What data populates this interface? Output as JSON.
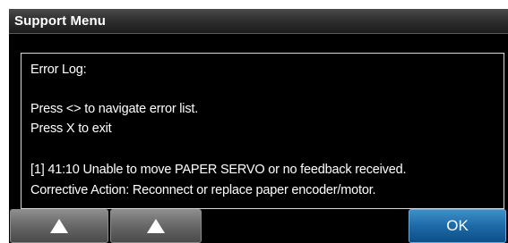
{
  "window": {
    "title": "Support Menu"
  },
  "log": {
    "header": "Error Log:",
    "instructions": [
      "Press <> to navigate error list.",
      "Press X to exit"
    ],
    "entries": [
      {
        "line": "[1] 41:10 Unable to move PAPER SERVO or no feedback received.",
        "action": "Corrective Action: Reconnect or replace paper encoder/motor."
      }
    ]
  },
  "softkeys": {
    "key1_icon": "up-triangle-icon",
    "key2_icon": "up-triangle-icon",
    "ok_label": "OK",
    "colors": {
      "gray": "#6a6a6a",
      "blue": "#1d6aa8"
    }
  }
}
